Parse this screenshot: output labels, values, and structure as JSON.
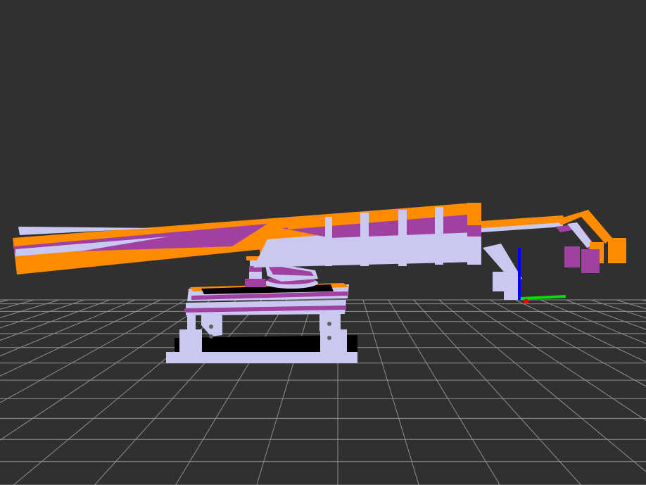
{
  "viewer": {
    "background_color": "#303030",
    "grid_color": "#a0a0a0",
    "model_colors": {
      "primary": "#ff8c00",
      "secondary": "#a040a0",
      "base": "#c8c8f0",
      "plate": "#000000"
    },
    "axes_colors": {
      "x": "#ff0000",
      "y": "#00e000",
      "z": "#0000ff"
    },
    "grid": true
  }
}
